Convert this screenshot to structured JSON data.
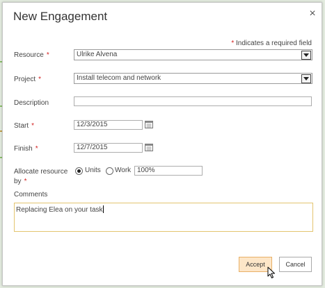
{
  "dialog": {
    "title": "New Engagement",
    "close_label": "×",
    "required_note": "Indicates a required field",
    "required_marker": "*"
  },
  "form": {
    "resource": {
      "label": "Resource",
      "value": "Ulrike Alvena"
    },
    "project": {
      "label": "Project",
      "value": "Install telecom and network"
    },
    "description": {
      "label": "Description",
      "value": ""
    },
    "start": {
      "label": "Start",
      "value": "12/3/2015"
    },
    "finish": {
      "label": "Finish",
      "value": "12/7/2015"
    },
    "allocate": {
      "label_line1": "Allocate resource",
      "label_line2": "by",
      "options": [
        "Units",
        "Work"
      ],
      "selected": "Units",
      "value": "100%"
    },
    "comments": {
      "label": "Comments",
      "value": "Replacing Elea on your task"
    }
  },
  "buttons": {
    "accept": "Accept",
    "cancel": "Cancel"
  },
  "colors": {
    "required_star": "#d21f1f",
    "accept_bg": "#fde6c8",
    "accept_border": "#e8b066",
    "comments_border": "#e3c46e"
  },
  "icons": [
    "close-icon",
    "dropdown-arrow-icon",
    "calendar-icon",
    "mouse-cursor-icon"
  ]
}
